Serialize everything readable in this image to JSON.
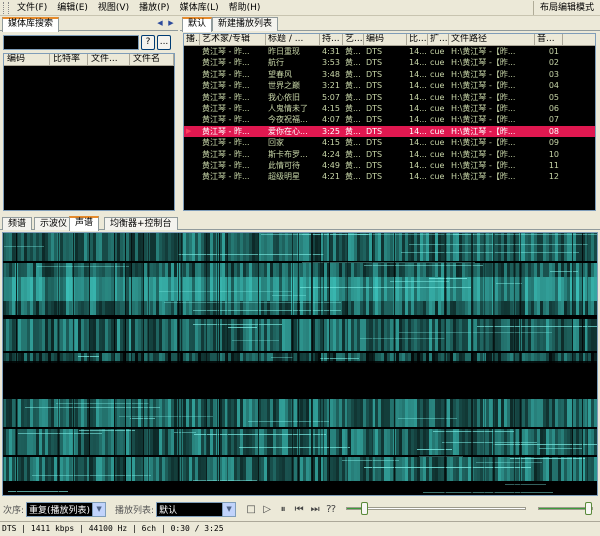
{
  "menu": [
    "文件(F)",
    "编辑(E)",
    "视图(V)",
    "播放(P)",
    "媒体库(L)",
    "帮助(H)"
  ],
  "layout_mode": "布局编辑模式",
  "library": {
    "tab": "媒体库搜索",
    "search_value": "",
    "help_button": "?",
    "dots_button": "...",
    "columns": [
      "编码",
      "比特率",
      "文件...",
      "文件名"
    ]
  },
  "playlist": {
    "tabs": [
      "默认",
      "新建播放列表"
    ],
    "columns": [
      "播...",
      "艺术家/专辑",
      "标题 / ...",
      "持...",
      "艺...",
      "编码",
      "比...",
      "扩...",
      "文件路径",
      "音..."
    ],
    "rows": [
      [
        "",
        "黄江琴 - 昨...",
        "昨日重现",
        "4:31",
        "黄...",
        "DTS",
        "14...",
        "cue",
        "H:\\黄江琴 -【昨...",
        "01"
      ],
      [
        "",
        "黄江琴 - 昨...",
        "航行",
        "3:53",
        "黄...",
        "DTS",
        "14...",
        "cue",
        "H:\\黄江琴 -【昨...",
        "02"
      ],
      [
        "",
        "黄江琴 - 昨...",
        "望春风",
        "3:48",
        "黄...",
        "DTS",
        "14...",
        "cue",
        "H:\\黄江琴 -【昨...",
        "03"
      ],
      [
        "",
        "黄江琴 - 昨...",
        "世界之巅",
        "3:21",
        "黄...",
        "DTS",
        "14...",
        "cue",
        "H:\\黄江琴 -【昨...",
        "04"
      ],
      [
        "",
        "黄江琴 - 昨...",
        "我心依旧",
        "5:07",
        "黄...",
        "DTS",
        "14...",
        "cue",
        "H:\\黄江琴 -【昨...",
        "05"
      ],
      [
        "",
        "黄江琴 - 昨...",
        "人鬼情未了",
        "4:15",
        "黄...",
        "DTS",
        "14...",
        "cue",
        "H:\\黄江琴 -【昨...",
        "06"
      ],
      [
        "",
        "黄江琴 - 昨...",
        "今夜祝福...",
        "4:07",
        "黄...",
        "DTS",
        "14...",
        "cue",
        "H:\\黄江琴 -【昨...",
        "07"
      ],
      [
        "▶",
        "黄江琴 - 昨...",
        "爱你在心...",
        "3:25",
        "黄...",
        "DTS",
        "14...",
        "cue",
        "H:\\黄江琴 -【昨...",
        "08"
      ],
      [
        "",
        "黄江琴 - 昨...",
        "回家",
        "4:15",
        "黄...",
        "DTS",
        "14...",
        "cue",
        "H:\\黄江琴 -【昨...",
        "09"
      ],
      [
        "",
        "黄江琴 - 昨...",
        "斯卡布罗...",
        "4:24",
        "黄...",
        "DTS",
        "14...",
        "cue",
        "H:\\黄江琴 -【昨...",
        "10"
      ],
      [
        "",
        "黄江琴 - 昨...",
        "此情可待",
        "4:49",
        "黄...",
        "DTS",
        "14...",
        "cue",
        "H:\\黄江琴 -【昨...",
        "11"
      ],
      [
        "",
        "黄江琴 - 昨...",
        "超级明星",
        "4:21",
        "黄...",
        "DTS",
        "14...",
        "cue",
        "H:\\黄江琴 -【昨...",
        "12"
      ]
    ],
    "current_index": 7
  },
  "visualizer": {
    "tabs": [
      "频谱",
      "示波仪",
      "声谱",
      "均衡器+控制台"
    ],
    "active_tab": 2
  },
  "controls": {
    "order_label": "次序:",
    "order_value": "重复(播放列表)",
    "playlist_label": "播放列表:",
    "playlist_value": "默认",
    "seek_fraction": 0.085,
    "volume_fraction": 0.98
  },
  "status": "DTS | 1411 kbps | 44100 Hz | 6ch | 0:30 / 3:25",
  "colors": {
    "accent_tab": "#e68b2c",
    "current_row": "#e01850",
    "row_text": "#c8d6a8",
    "spectrum": "#3ec8c0"
  }
}
